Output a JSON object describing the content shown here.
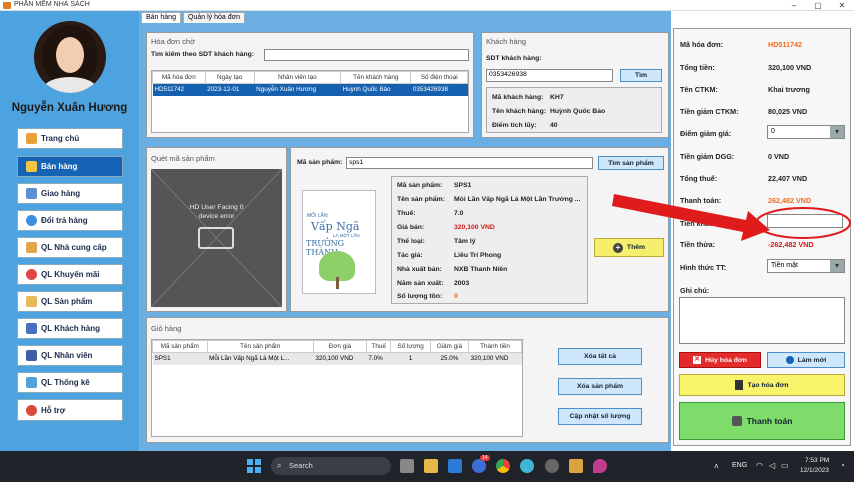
{
  "window": {
    "title": "PHẦN MỀM NHÀ SÁCH"
  },
  "user": {
    "name": "Nguyễn Xuân Hương"
  },
  "nav": [
    {
      "label": "Trang chủ",
      "icon": "home-icon"
    },
    {
      "label": "Bán hàng",
      "icon": "cart-icon"
    },
    {
      "label": "Giao hàng",
      "icon": "truck-icon"
    },
    {
      "label": "Đổi trả hàng",
      "icon": "refresh-icon"
    },
    {
      "label": "QL Nhà cung cấp",
      "icon": "handshake-icon"
    },
    {
      "label": "QL Khuyến mãi",
      "icon": "sale-icon"
    },
    {
      "label": "QL Sản phẩm",
      "icon": "box-icon"
    },
    {
      "label": "QL Khách hàng",
      "icon": "customers-icon"
    },
    {
      "label": "QL Nhân viên",
      "icon": "staff-icon"
    },
    {
      "label": "QL Thống kê",
      "icon": "chart-icon"
    },
    {
      "label": "Hỗ trợ",
      "icon": "help-icon"
    }
  ],
  "tabs": [
    "Bán hàng",
    "Quản lý hóa đơn"
  ],
  "pending": {
    "title": "Hóa đơn chờ",
    "search_label": "Tìm kiếm theo SDT khách hàng:",
    "search_value": "",
    "columns": [
      "Mã hóa đơn",
      "Ngày tạo",
      "Nhân viên tạo",
      "Tên khách hàng",
      "Số điện thoại"
    ],
    "rows": [
      [
        "HD511742",
        "2023-12-01",
        "Nguyễn Xuân Hương",
        "Huỳnh Quốc Bảo",
        "0353426938"
      ]
    ]
  },
  "customer": {
    "title": "Khách hàng",
    "phone_label": "SDT khách hàng:",
    "phone_value": "0353426938",
    "find_btn": "Tìm",
    "code_label": "Mã khách hàng:",
    "code_value": "KH7",
    "name_label": "Tên khách hàng:",
    "name_value": "Huỳnh Quốc Bảo",
    "points_label": "Điểm tích lũy:",
    "points_value": "40"
  },
  "scan": {
    "title": "Quét mã sản phẩm",
    "device_line1": "HD User Facing 0",
    "device_line2": "device error"
  },
  "product": {
    "code_label": "Mã sản phẩm:",
    "code_input": "sps1",
    "find_btn": "Tìm sản phẩm",
    "cover_title_1": "MỖI LẦN",
    "cover_title_2": "Vấp Ngã",
    "cover_title_3": "LÀ MỘT LẦN",
    "cover_title_4": "TRƯỞNG THÀNH",
    "fields": [
      {
        "label": "Mã sản phẩm:",
        "value": "SPS1"
      },
      {
        "label": "Tên sản phẩm:",
        "value": "Mỗi Lần Vấp Ngã Là Một Lần Trưởng ..."
      },
      {
        "label": "Thuế:",
        "value": "7.0"
      },
      {
        "label": "Giá bán:",
        "value": "320,100 VND"
      },
      {
        "label": "Thể loại:",
        "value": "Tâm lý"
      },
      {
        "label": "Tác giả:",
        "value": "Liêu Trí Phong"
      },
      {
        "label": "Nhà xuất bản:",
        "value": "NXB Thanh Niên"
      },
      {
        "label": "Năm sản xuất:",
        "value": "2003"
      },
      {
        "label": "Số lượng tồn:",
        "value": "9"
      }
    ],
    "add_btn": "Thêm"
  },
  "cart": {
    "title": "Giỏ hàng",
    "columns": [
      "Mã sản phẩm",
      "Tên sản phẩm",
      "Đơn giá",
      "Thuế",
      "Số lượng",
      "Giảm giá",
      "Thành tiền"
    ],
    "rows": [
      [
        "SPS1",
        "Mỗi Lần Vấp Ngã Là Một L...",
        "320,100 VND",
        "7.0%",
        "1",
        "25.0%",
        "320,100 VND"
      ]
    ],
    "btn_clear": "Xóa tất cả",
    "btn_remove": "Xóa sản phẩm",
    "btn_update": "Cập nhật số lượng"
  },
  "invoice": {
    "code_label": "Mã hóa đơn:",
    "code_value": "HD511742",
    "total_label": "Tổng tiền:",
    "total_value": "320,100 VND",
    "ctkm_label": "Tên CTKM:",
    "ctkm_value": "Khai trương",
    "ctkm_disc_label": "Tiền giảm CTKM:",
    "ctkm_disc_value": "80,025 VND",
    "points_label": "Điểm giảm giá:",
    "points_value": "0",
    "dgg_label": "Tiền giảm DGG:",
    "dgg_value": "0 VND",
    "tax_label": "Tổng thuế:",
    "tax_value": "22,407 VND",
    "pay_label": "Thanh toán:",
    "pay_value": "262,482 VND",
    "given_label": "Tiền khách đưa:",
    "given_value": "",
    "change_label": "Tiền thừa:",
    "change_value": "-262,482 VND",
    "method_label": "Hình thức TT:",
    "method_value": "Tiền mặt",
    "note_label": "Ghi chú:",
    "btn_cancel": "Hủy hóa đơn",
    "btn_reset": "Làm mới",
    "btn_create": "Tạo hóa đơn",
    "btn_pay": "Thanh toán"
  },
  "taskbar": {
    "search": "Search",
    "lang": "ENG",
    "time": "7:53 PM",
    "date": "12/1/2023",
    "badge": "14"
  },
  "colors": {
    "sidebar": "#4da3e0",
    "accent": "#1563b4",
    "annotation": "#e01b1b"
  }
}
